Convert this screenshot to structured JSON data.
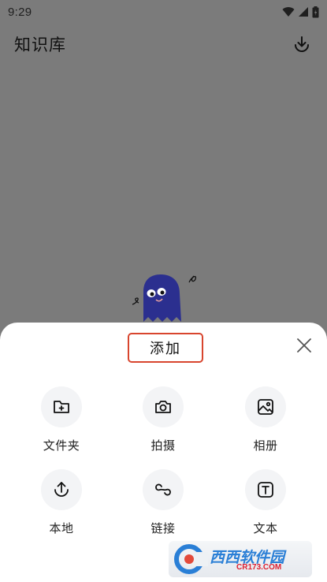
{
  "status_bar": {
    "time": "9:29",
    "icons": [
      "wifi-icon",
      "signal-icon",
      "battery-icon"
    ]
  },
  "header": {
    "title": "知识库",
    "action_icon": "download-icon"
  },
  "sheet": {
    "title": "添加",
    "close_icon": "close-icon",
    "options": [
      {
        "label": "文件夹",
        "icon": "folder-add-icon"
      },
      {
        "label": "拍摄",
        "icon": "camera-icon"
      },
      {
        "label": "相册",
        "icon": "image-icon"
      },
      {
        "label": "本地",
        "icon": "upload-icon"
      },
      {
        "label": "链接",
        "icon": "link-icon"
      },
      {
        "label": "文本",
        "icon": "text-icon"
      }
    ]
  },
  "watermark": {
    "text": "西西软件园",
    "sub": "CR173.COM"
  },
  "colors": {
    "overlay": "#7b7b7b",
    "sheet_bg": "#ffffff",
    "highlight_border": "#d8452e",
    "mascot": "#2b2f8f",
    "icon_circle": "#f3f4f6"
  }
}
